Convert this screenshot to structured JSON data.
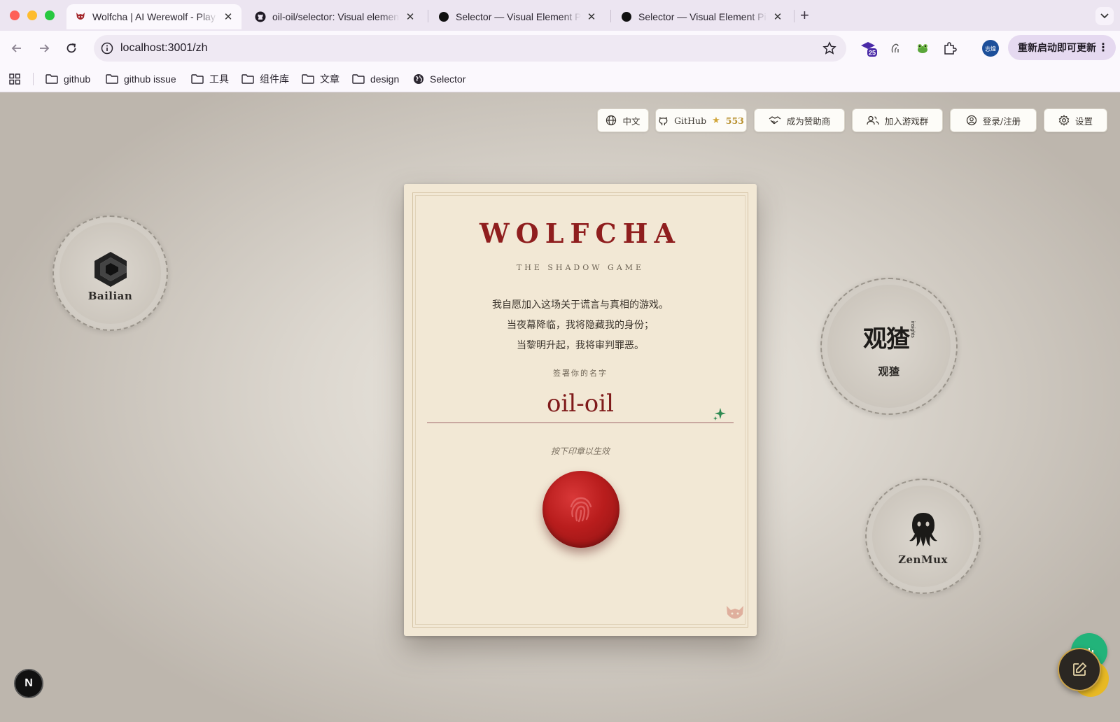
{
  "browser": {
    "tabs": [
      {
        "title": "Wolfcha | AI Werewolf - Play W",
        "icon": "wolf-favicon",
        "active": true
      },
      {
        "title": "oil-oil/selector: Visual elemen",
        "icon": "github-favicon",
        "active": false
      },
      {
        "title": "Selector — Visual Element Pic",
        "icon": "dot-favicon",
        "active": false
      },
      {
        "title": "Selector — Visual Element Pic",
        "icon": "dot-favicon",
        "active": false
      }
    ],
    "url": "localhost:3001/zh",
    "ext_badge": "25",
    "avatar_text": "志煌",
    "update_label": "重新启动即可更新",
    "bookmarks": [
      "github",
      "github issue",
      "工具",
      "组件库",
      "文章",
      "design",
      "Selector"
    ]
  },
  "topnav": {
    "language": "中文",
    "github": "GitHub",
    "stars": "553",
    "sponsor": "成为赞助商",
    "join": "加入游戏群",
    "login": "登录/注册",
    "settings": "设置"
  },
  "sponsors": {
    "bailian": "Bailian",
    "guancha_logo": "观猹",
    "guancha_sub": "insights",
    "guancha": "观猹",
    "zenmux": "ZenMux"
  },
  "card": {
    "title": "WOLFCHA",
    "tagline": "THE SHADOW GAME",
    "oath_lines": [
      "我自愿加入这场关于谎言与真相的游戏。",
      "当夜幕降临，我将隐藏我的身份；",
      "当黎明升起，我将审判罪恶。"
    ],
    "sign_label": "签署你的名字",
    "player_name": "oil-oil",
    "hint": "按下印章以生效"
  },
  "badge": "N",
  "colors": {
    "brand_red": "#8f1e1e",
    "seal_red": "#b91d1d",
    "paper": "#f2e8d5",
    "gold": "#b8902f",
    "green": "#22b37a"
  }
}
